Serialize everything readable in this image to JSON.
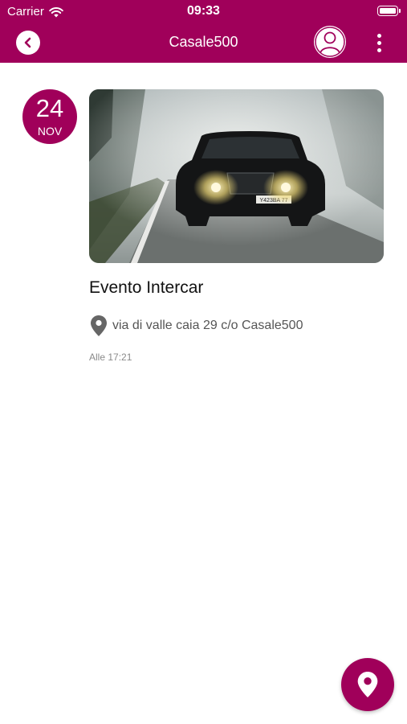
{
  "status_bar": {
    "carrier": "Carrier",
    "time": "09:33"
  },
  "nav": {
    "title": "Casale500",
    "back_icon": "chevron-left-icon",
    "profile_icon": "user-icon",
    "menu_icon": "more-vertical-icon"
  },
  "event": {
    "day": "24",
    "month": "NOV",
    "image_alt": "Hyundai SUV driving on a foggy forest road",
    "title": "Evento Intercar",
    "address": "via di valle caia 29 c/o Casale500",
    "time": "Alle 17:21",
    "plate": "Y423BA 77"
  },
  "fab": {
    "icon": "map-pin-icon"
  },
  "colors": {
    "brand": "#a0005a",
    "title_text": "#111111",
    "secondary_text": "#555555"
  }
}
